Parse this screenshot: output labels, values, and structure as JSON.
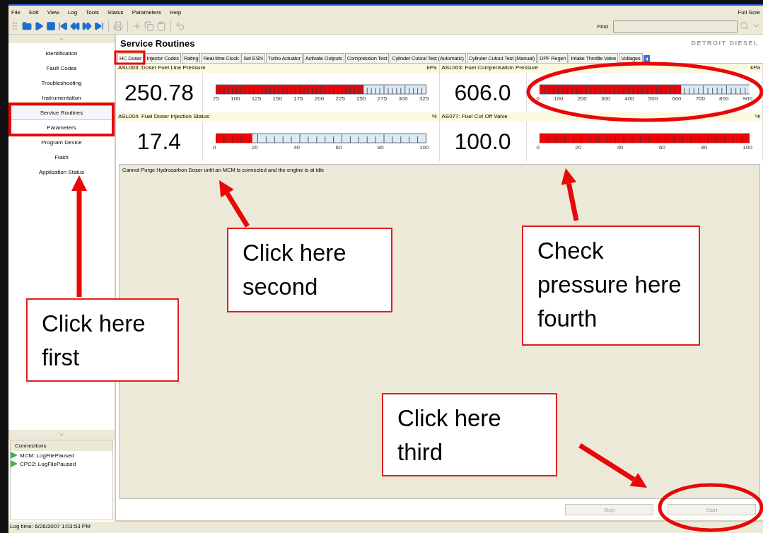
{
  "menu": [
    "File",
    "Edit",
    "View",
    "Log",
    "Tools",
    "Status",
    "Parameters",
    "Help"
  ],
  "menu_right": "Full Scre",
  "toolbar": {
    "find_label": "Find"
  },
  "sidebar": {
    "items": [
      {
        "label": "Identification",
        "selected": false
      },
      {
        "label": "Fault Codes",
        "selected": false
      },
      {
        "label": "Troubleshooting",
        "selected": false
      },
      {
        "label": "Instrumentation",
        "selected": false
      },
      {
        "label": "Service Routines",
        "selected": true
      },
      {
        "label": "Parameters",
        "selected": false
      },
      {
        "label": "Program Device",
        "selected": false
      },
      {
        "label": "Flash",
        "selected": false
      },
      {
        "label": "Application Status",
        "selected": false
      }
    ]
  },
  "connections": {
    "title": "Connections",
    "items": [
      "MCM: LogFilePaused",
      "CPC2: LogFilePaused"
    ]
  },
  "header": {
    "title": "Service Routines",
    "logo_text": "DETROIT DIESEL"
  },
  "tabs": [
    {
      "label": "HC Doser",
      "selected": true
    },
    {
      "label": "Injector Codes",
      "selected": false
    },
    {
      "label": "Rating",
      "selected": false
    },
    {
      "label": "Real-time Clock",
      "selected": false
    },
    {
      "label": "Set ESN",
      "selected": false
    },
    {
      "label": "Turbo Actuator",
      "selected": false
    },
    {
      "label": "Activate Outputs",
      "selected": false
    },
    {
      "label": "Compression Test",
      "selected": false
    },
    {
      "label": "Cylinder Cutout Test (Automatic)",
      "selected": false
    },
    {
      "label": "Cylinder Cutout Test (Manual)",
      "selected": false
    },
    {
      "label": "DPF Regen",
      "selected": false
    },
    {
      "label": "Intake Throttle Valve",
      "selected": false
    },
    {
      "label": "Voltages",
      "selected": false
    }
  ],
  "gauges": [
    {
      "title": "ASL003: Doser Fuel Line Pressure",
      "unit": "kPa",
      "value": "250.78",
      "level": 0.703,
      "ticks": [
        "75",
        "100",
        "125",
        "150",
        "175",
        "200",
        "225",
        "250",
        "275",
        "300",
        "325"
      ]
    },
    {
      "title": "ASL003: Fuel Compensation Pressure",
      "unit": "kPa",
      "value": "606.0",
      "level": 0.673,
      "ticks": [
        "0",
        "100",
        "200",
        "300",
        "400",
        "500",
        "600",
        "700",
        "800",
        "900"
      ]
    },
    {
      "title": "ASL004: Fuel Doser Injection Status",
      "unit": "%",
      "value": "17.4",
      "level": 0.174,
      "ticks": [
        "0",
        "20",
        "40",
        "60",
        "80",
        "100"
      ]
    },
    {
      "title": "AS077: Fuel Cut Off Valve",
      "unit": "%",
      "value": "100.0",
      "level": 1.0,
      "ticks": [
        "0",
        "20",
        "40",
        "60",
        "80",
        "100"
      ]
    }
  ],
  "message": "Cannot Purge Hydrocarbon Doser until an MCM is connected and the engine is at idle",
  "buttons": [
    {
      "label": "Stop",
      "disabled": true
    },
    {
      "label": "Start",
      "disabled": true
    }
  ],
  "status_bar": "Log time: 6/26/2007 1:03:53 PM",
  "callouts": [
    {
      "kind": "first",
      "text": "Click here first"
    },
    {
      "kind": "second",
      "text": "Click here second"
    },
    {
      "kind": "fourth",
      "text": "Check pressure here fourth"
    },
    {
      "kind": "third",
      "text": "Click here third"
    }
  ]
}
